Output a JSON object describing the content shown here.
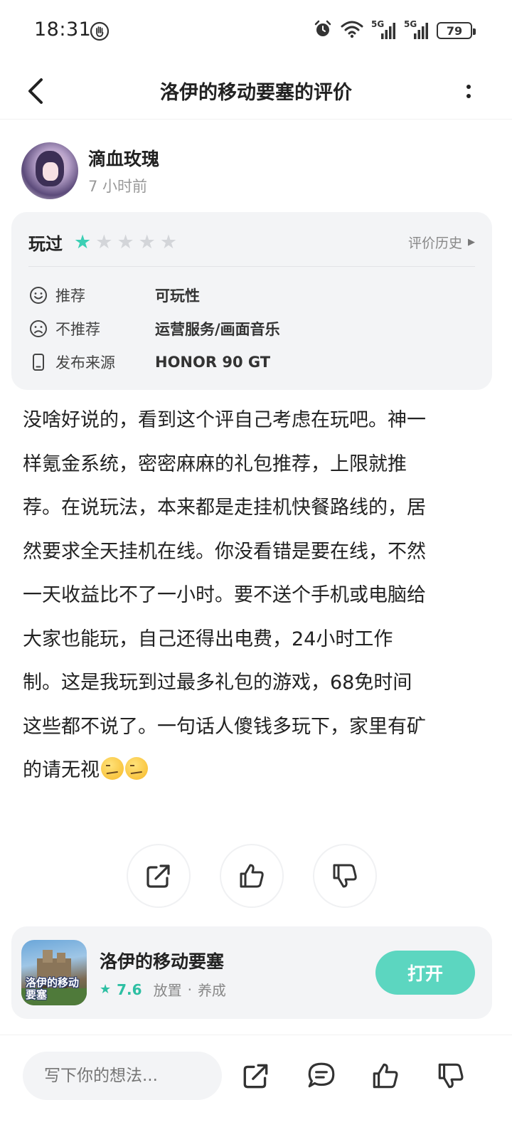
{
  "status_bar": {
    "time": "18:31",
    "network_1": "5G",
    "network_2": "5G",
    "battery": "79"
  },
  "header": {
    "title": "洛伊的移动要塞的评价"
  },
  "user": {
    "name": "滴血玫瑰",
    "time": "7 小时前"
  },
  "rating_card": {
    "played_label": "玩过",
    "stars": 1,
    "max_stars": 5,
    "history_label": "评价历史",
    "attributes": [
      {
        "icon": "smile-icon",
        "label": "推荐",
        "value": "可玩性"
      },
      {
        "icon": "frown-icon",
        "label": "不推荐",
        "value": "运营服务/画面音乐"
      },
      {
        "icon": "phone-icon",
        "label": "发布来源",
        "value": "HONOR 90 GT"
      }
    ]
  },
  "review": {
    "lines": [
      "没啥好说的，看到这个评自己考虑在玩吧。神一",
      "样氪金系统，密密麻麻的礼包推荐，上限就推",
      "荐。在说玩法，本来都是走挂机快餐路线的，居",
      "然要求全天挂机在线。你没看错是要在线，不然",
      "一天收益比不了一小时。要不送个手机或电脑给",
      "大家也能玩，自己还得出电费，24小时工作",
      "制。这是我玩到过最多礼包的游戏，68免时间",
      "这些都不说了。一句话人傻钱多玩下，家里有矿",
      "的请无视"
    ],
    "emoji_count": 2
  },
  "game": {
    "name": "洛伊的移动要塞",
    "icon_label": "洛伊的移动要塞",
    "score": "7.6",
    "tag1": "放置",
    "separator": "·",
    "tag2": "养成",
    "open_label": "打开"
  },
  "bottom_bar": {
    "comment_placeholder": "写下你的想法..."
  },
  "colors": {
    "accent": "#3ccfb4",
    "open_button": "#5cd6c0",
    "card_bg": "#f3f4f6"
  }
}
